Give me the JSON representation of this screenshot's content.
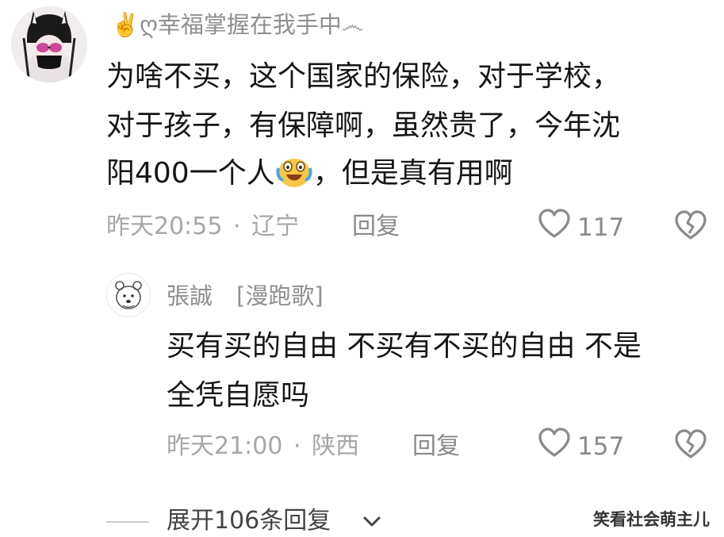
{
  "comments": [
    {
      "username": "幸福掌握在我手中",
      "username_decor_prefix": "✌️ღ",
      "username_decor_suffix": "෴",
      "lines": [
        "为啥不买，这个国家的保险，对于学校，",
        "对于孩子，有保障啊，虽然贵了，今年沈",
        "阳400一个人"
      ],
      "emoji": "crying-laughing-emoji",
      "line3_tail": "，但是真有用啊",
      "time": "昨天20:55",
      "location": "辽宁",
      "meta_separator": "·",
      "reply_label": "回复",
      "like_count": "117"
    },
    {
      "username": "張誠",
      "user_tag": "[漫跑歌]",
      "lines": [
        "买有买的自由 不买有不买的自由 不是",
        "全凭自愿吗"
      ],
      "time": "昨天21:00",
      "location": "陕西",
      "meta_separator": "·",
      "reply_label": "回复",
      "like_count": "157"
    }
  ],
  "expand_replies_label": "展开106条回复",
  "watermark": "笑看社会萌主儿",
  "icons": {
    "like": "heart-outline-icon",
    "dislike": "broken-heart-icon",
    "expand": "chevron-down-icon"
  },
  "colors": {
    "text_primary": "#161616",
    "text_secondary": "#8f8f8f",
    "background": "#ffffff"
  }
}
